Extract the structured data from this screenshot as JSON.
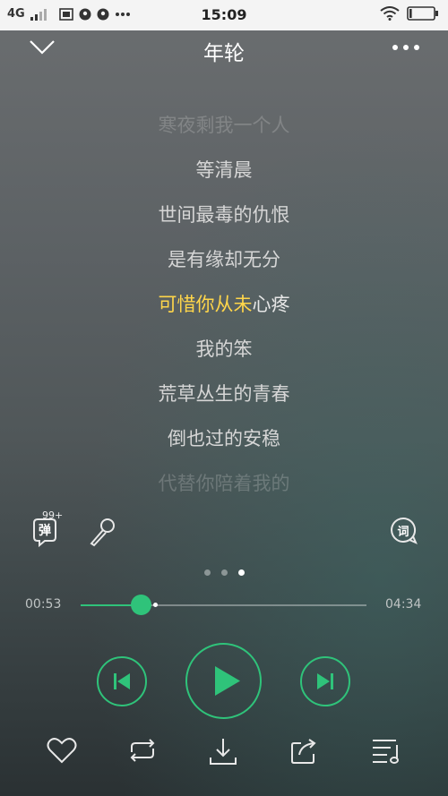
{
  "status_bar": {
    "network": "4G",
    "time": "15:09",
    "battery_level": 0.1
  },
  "header": {
    "title": "年轮"
  },
  "lyrics": {
    "lines": [
      {
        "text": "寒夜剩我一个人",
        "state": "faded"
      },
      {
        "text": "等清晨",
        "state": "normal"
      },
      {
        "text": "世间最毒的仇恨",
        "state": "normal"
      },
      {
        "text": "是有缘却无分",
        "state": "normal"
      },
      {
        "text": "可惜你从未心疼",
        "state": "active",
        "sung": "可惜你从未",
        "unsung": "心疼"
      },
      {
        "text": "我的笨",
        "state": "normal"
      },
      {
        "text": "荒草丛生的青春",
        "state": "normal"
      },
      {
        "text": "倒也过的安稳",
        "state": "normal"
      },
      {
        "text": "代替你陪着我的",
        "state": "faded"
      }
    ]
  },
  "tools": {
    "danmaku_label": "弹",
    "danmaku_count": "99+",
    "lyric_label": "词"
  },
  "pager": {
    "count": 3,
    "active_index": 2
  },
  "progress": {
    "elapsed": "00:53",
    "total": "04:34",
    "played_fraction": 0.21,
    "buffered_fraction": 0.26
  },
  "colors": {
    "accent": "#2fc37a",
    "active_lyric": "#ffd64a"
  },
  "icons": {
    "collapse": "chevron-down-icon",
    "more": "more-dots-icon",
    "microphone": "microphone-icon",
    "previous": "previous-track-icon",
    "play": "play-icon",
    "next": "next-track-icon",
    "favorite": "heart-icon",
    "repeat": "repeat-icon",
    "download": "download-icon",
    "share": "share-icon",
    "playlist": "playlist-icon"
  }
}
